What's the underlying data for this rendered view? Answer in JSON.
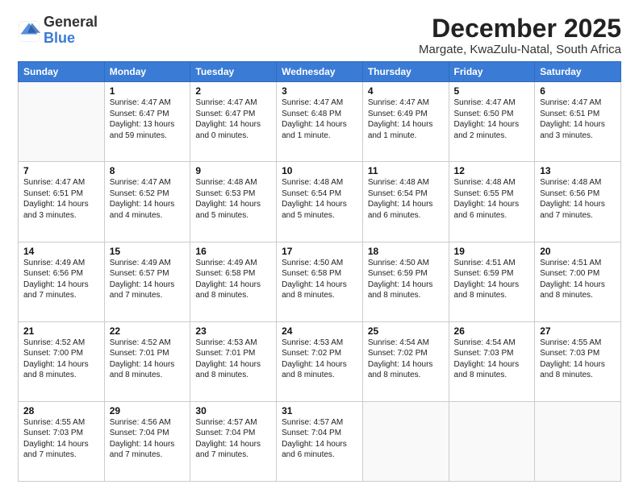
{
  "logo": {
    "general": "General",
    "blue": "Blue"
  },
  "title": "December 2025",
  "location": "Margate, KwaZulu-Natal, South Africa",
  "days_header": [
    "Sunday",
    "Monday",
    "Tuesday",
    "Wednesday",
    "Thursday",
    "Friday",
    "Saturday"
  ],
  "weeks": [
    [
      {
        "num": "",
        "detail": ""
      },
      {
        "num": "1",
        "detail": "Sunrise: 4:47 AM\nSunset: 6:47 PM\nDaylight: 13 hours\nand 59 minutes."
      },
      {
        "num": "2",
        "detail": "Sunrise: 4:47 AM\nSunset: 6:47 PM\nDaylight: 14 hours\nand 0 minutes."
      },
      {
        "num": "3",
        "detail": "Sunrise: 4:47 AM\nSunset: 6:48 PM\nDaylight: 14 hours\nand 1 minute."
      },
      {
        "num": "4",
        "detail": "Sunrise: 4:47 AM\nSunset: 6:49 PM\nDaylight: 14 hours\nand 1 minute."
      },
      {
        "num": "5",
        "detail": "Sunrise: 4:47 AM\nSunset: 6:50 PM\nDaylight: 14 hours\nand 2 minutes."
      },
      {
        "num": "6",
        "detail": "Sunrise: 4:47 AM\nSunset: 6:51 PM\nDaylight: 14 hours\nand 3 minutes."
      }
    ],
    [
      {
        "num": "7",
        "detail": "Sunrise: 4:47 AM\nSunset: 6:51 PM\nDaylight: 14 hours\nand 3 minutes."
      },
      {
        "num": "8",
        "detail": "Sunrise: 4:47 AM\nSunset: 6:52 PM\nDaylight: 14 hours\nand 4 minutes."
      },
      {
        "num": "9",
        "detail": "Sunrise: 4:48 AM\nSunset: 6:53 PM\nDaylight: 14 hours\nand 5 minutes."
      },
      {
        "num": "10",
        "detail": "Sunrise: 4:48 AM\nSunset: 6:54 PM\nDaylight: 14 hours\nand 5 minutes."
      },
      {
        "num": "11",
        "detail": "Sunrise: 4:48 AM\nSunset: 6:54 PM\nDaylight: 14 hours\nand 6 minutes."
      },
      {
        "num": "12",
        "detail": "Sunrise: 4:48 AM\nSunset: 6:55 PM\nDaylight: 14 hours\nand 6 minutes."
      },
      {
        "num": "13",
        "detail": "Sunrise: 4:48 AM\nSunset: 6:56 PM\nDaylight: 14 hours\nand 7 minutes."
      }
    ],
    [
      {
        "num": "14",
        "detail": "Sunrise: 4:49 AM\nSunset: 6:56 PM\nDaylight: 14 hours\nand 7 minutes."
      },
      {
        "num": "15",
        "detail": "Sunrise: 4:49 AM\nSunset: 6:57 PM\nDaylight: 14 hours\nand 7 minutes."
      },
      {
        "num": "16",
        "detail": "Sunrise: 4:49 AM\nSunset: 6:58 PM\nDaylight: 14 hours\nand 8 minutes."
      },
      {
        "num": "17",
        "detail": "Sunrise: 4:50 AM\nSunset: 6:58 PM\nDaylight: 14 hours\nand 8 minutes."
      },
      {
        "num": "18",
        "detail": "Sunrise: 4:50 AM\nSunset: 6:59 PM\nDaylight: 14 hours\nand 8 minutes."
      },
      {
        "num": "19",
        "detail": "Sunrise: 4:51 AM\nSunset: 6:59 PM\nDaylight: 14 hours\nand 8 minutes."
      },
      {
        "num": "20",
        "detail": "Sunrise: 4:51 AM\nSunset: 7:00 PM\nDaylight: 14 hours\nand 8 minutes."
      }
    ],
    [
      {
        "num": "21",
        "detail": "Sunrise: 4:52 AM\nSunset: 7:00 PM\nDaylight: 14 hours\nand 8 minutes."
      },
      {
        "num": "22",
        "detail": "Sunrise: 4:52 AM\nSunset: 7:01 PM\nDaylight: 14 hours\nand 8 minutes."
      },
      {
        "num": "23",
        "detail": "Sunrise: 4:53 AM\nSunset: 7:01 PM\nDaylight: 14 hours\nand 8 minutes."
      },
      {
        "num": "24",
        "detail": "Sunrise: 4:53 AM\nSunset: 7:02 PM\nDaylight: 14 hours\nand 8 minutes."
      },
      {
        "num": "25",
        "detail": "Sunrise: 4:54 AM\nSunset: 7:02 PM\nDaylight: 14 hours\nand 8 minutes."
      },
      {
        "num": "26",
        "detail": "Sunrise: 4:54 AM\nSunset: 7:03 PM\nDaylight: 14 hours\nand 8 minutes."
      },
      {
        "num": "27",
        "detail": "Sunrise: 4:55 AM\nSunset: 7:03 PM\nDaylight: 14 hours\nand 8 minutes."
      }
    ],
    [
      {
        "num": "28",
        "detail": "Sunrise: 4:55 AM\nSunset: 7:03 PM\nDaylight: 14 hours\nand 7 minutes."
      },
      {
        "num": "29",
        "detail": "Sunrise: 4:56 AM\nSunset: 7:04 PM\nDaylight: 14 hours\nand 7 minutes."
      },
      {
        "num": "30",
        "detail": "Sunrise: 4:57 AM\nSunset: 7:04 PM\nDaylight: 14 hours\nand 7 minutes."
      },
      {
        "num": "31",
        "detail": "Sunrise: 4:57 AM\nSunset: 7:04 PM\nDaylight: 14 hours\nand 6 minutes."
      },
      {
        "num": "",
        "detail": ""
      },
      {
        "num": "",
        "detail": ""
      },
      {
        "num": "",
        "detail": ""
      }
    ]
  ]
}
